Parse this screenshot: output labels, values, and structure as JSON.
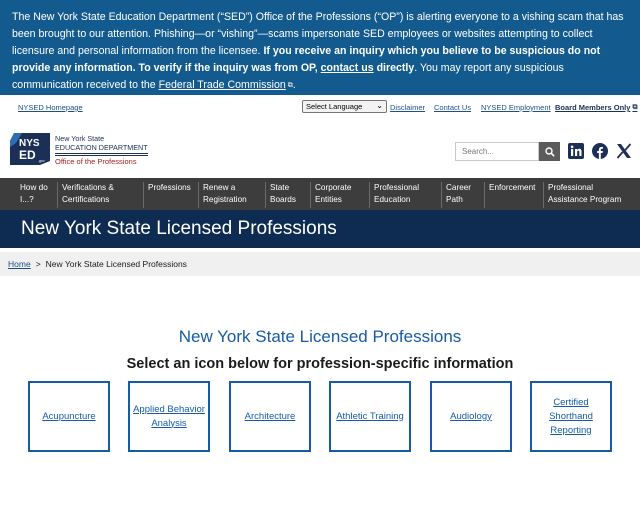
{
  "alert": {
    "p1": "The New York State Education Department (“SED”) Office of the Professions (“OP”) is alerting everyone to a vishing scam that has been brought to our attention. Phishing—or “vishing”—scams impersonate SED employees or websites attempting to collect licensure and personal information from the licensee. ",
    "bold1": "If you receive an inquiry which you believe to be suspicious do not provide any information. To verify if the inquiry was from OP, ",
    "contact_link": "contact us",
    "bold2": " directly",
    "p2": ". You may report any suspicious communication received to the ",
    "ftc_link": "Federal Trade Commission",
    "p3": "."
  },
  "utility": {
    "home": "NYSED Homepage",
    "language": "Select Language",
    "disclaimer": "Disclaimer",
    "contact": "Contact Us",
    "employment": "NYSED Employment",
    "members": "Board Members Only"
  },
  "header": {
    "logo_line1": "New York State",
    "logo_line2": "EDUCATION DEPARTMENT",
    "logo_line3": "Office of the Professions",
    "logo_mark": "NYS ED",
    "search_placeholder": "Search..."
  },
  "nav": [
    {
      "line1": "How do",
      "line2": "I...?"
    },
    {
      "line1": "Verifications &",
      "line2": "Certifications"
    },
    {
      "line1": "Professions",
      "line2": ""
    },
    {
      "line1": "Renew a",
      "line2": "Registration"
    },
    {
      "line1": "State",
      "line2": "Boards"
    },
    {
      "line1": "Corporate",
      "line2": "Entities"
    },
    {
      "line1": "Professional",
      "line2": "Education"
    },
    {
      "line1": "Career",
      "line2": "Path"
    },
    {
      "line1": "Enforcement",
      "line2": ""
    },
    {
      "line1": "Professional",
      "line2": "Assistance Program"
    }
  ],
  "page_title": "New York State Licensed Professions",
  "breadcrumb": {
    "home": "Home",
    "sep": ">",
    "current": "New York State Licensed Professions"
  },
  "main": {
    "heading": "New York State Licensed Professions",
    "subheading": "Select an icon below for profession-specific information",
    "cards": [
      {
        "label": "Acupuncture"
      },
      {
        "label": "Applied Behavior Analysis"
      },
      {
        "label": "Architecture"
      },
      {
        "label": "Athletic Training"
      },
      {
        "label": "Audiology"
      },
      {
        "label": "Certified Shorthand Reporting"
      }
    ]
  },
  "colors": {
    "banner": "#135a8e",
    "nav": "#3d3d3d",
    "title_band": "#0e2b52",
    "link": "#155ba6"
  }
}
